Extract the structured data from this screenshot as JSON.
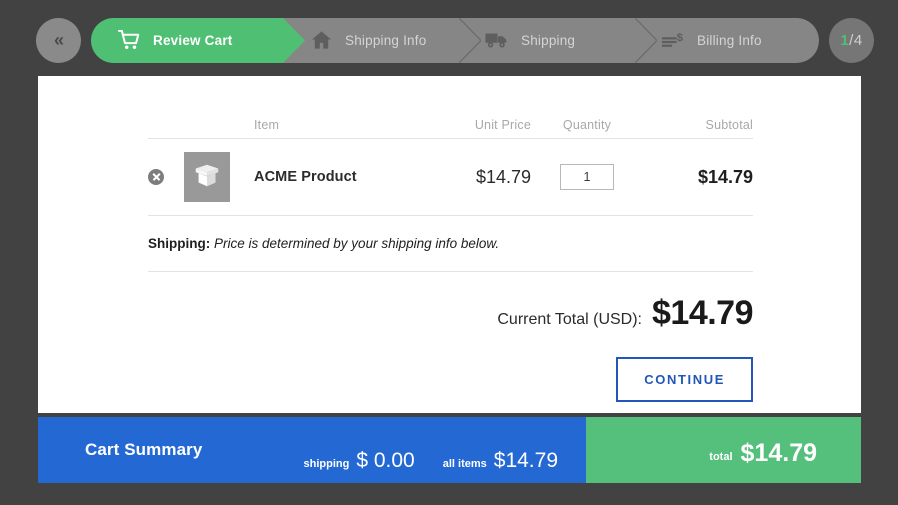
{
  "theme": {
    "page_background": "#424242",
    "accent_green": "#4FBF74",
    "summary_blue": "#2468D4",
    "total_green": "#55C07C",
    "step_gray": "#868686",
    "button_blue": "#2256b8"
  },
  "progress": {
    "back_button": {
      "icon": "double-chevron-left-icon",
      "label": "«"
    },
    "steps": [
      {
        "label": "Review Cart",
        "icon": "shopping-cart-icon",
        "active": true
      },
      {
        "label": "Shipping Info",
        "icon": "home-icon",
        "active": false
      },
      {
        "label": "Shipping",
        "icon": "delivery-truck-icon",
        "active": false
      },
      {
        "label": "Billing Info",
        "icon": "invoice-dollar-icon",
        "active": false
      }
    ],
    "counter": {
      "current": "1",
      "separator": " / ",
      "total": "4"
    }
  },
  "cart": {
    "columns": {
      "item": "Item",
      "unit_price": "Unit Price",
      "quantity": "Quantity",
      "subtotal": "Subtotal"
    },
    "rows": [
      {
        "remove_icon": "remove-circle-icon",
        "thumbnail_icon": "open-box-icon",
        "name": "ACME Product",
        "unit_price": "$14.79",
        "quantity": "1",
        "subtotal": "$14.79"
      }
    ],
    "shipping_note": {
      "label": "Shipping:",
      "text": "Price is determined by your shipping info below."
    },
    "total": {
      "label": "Current Total (USD):",
      "value": "$14.79"
    },
    "continue_button": "CONTINUE"
  },
  "summary": {
    "title": "Cart Summary",
    "shipping_label": "shipping",
    "shipping_value": "$ 0.00",
    "all_items_label": "all items",
    "all_items_value": "$14.79",
    "total_label": "total",
    "total_value": "$14.79"
  }
}
